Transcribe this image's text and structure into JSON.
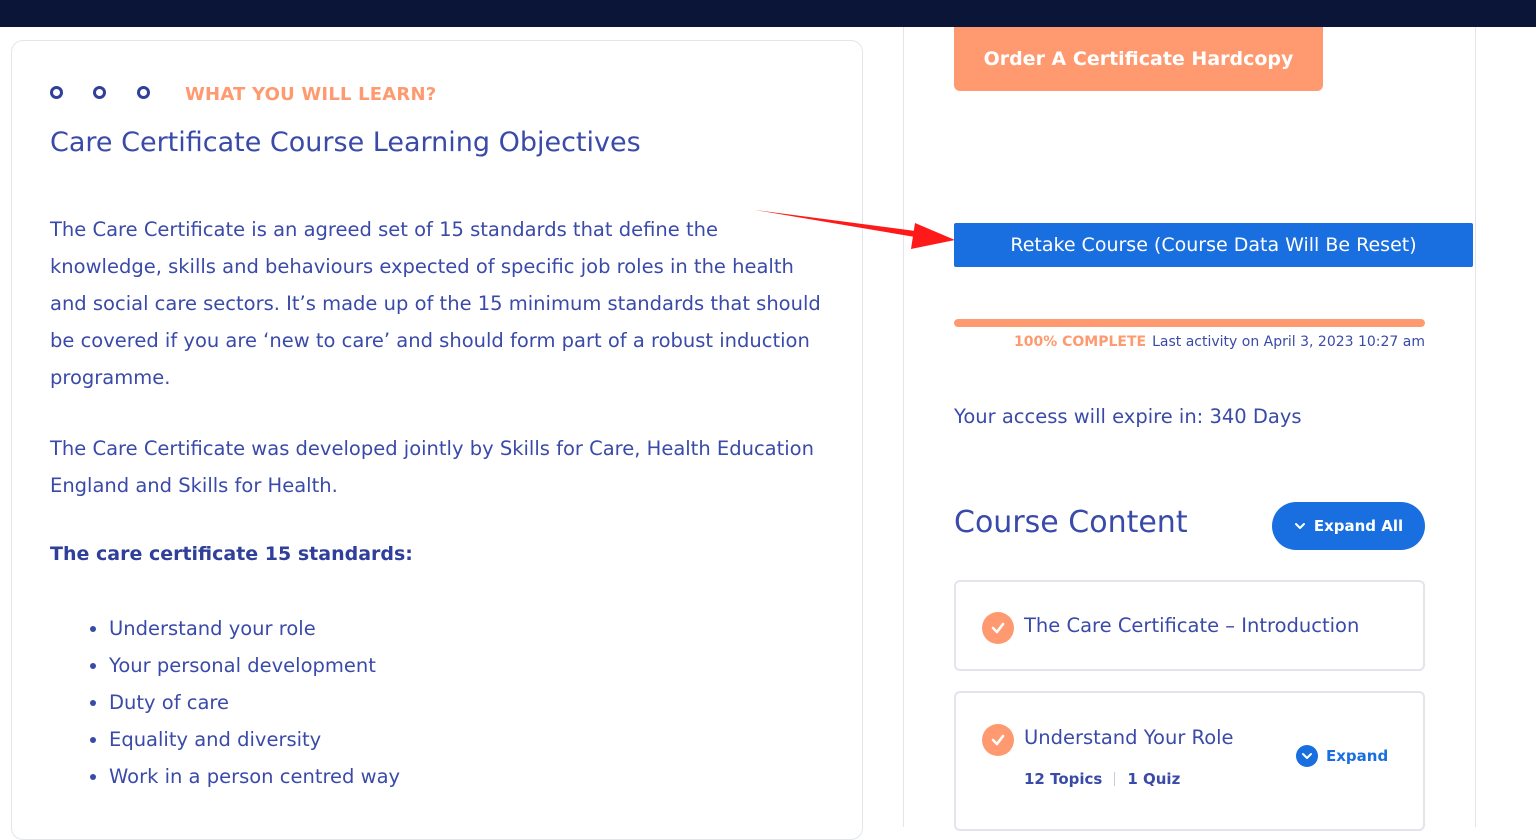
{
  "colors": {
    "navy": "#0a1538",
    "text": "#3a4aa8",
    "accent_orange": "#ff9a70",
    "primary_blue": "#1a6fe0",
    "arrow_red": "#ff1a1a"
  },
  "main": {
    "eyebrow": "WHAT YOU WILL LEARN?",
    "title": "Care Certificate Course Learning Objectives",
    "paragraph_1": "The Care Certificate is an agreed set of 15 standards that define the knowledge, skills and behaviours expected of specific job roles in the health and social care sectors. It’s made up of the 15 minimum standards that should be covered if you are ‘new to care’ and should form part of a robust induction programme.",
    "paragraph_2": "The Care Certificate was developed jointly by Skills for Care, Health Education England and Skills for Health.",
    "standards_heading": "The care certificate 15 standards:",
    "standards": [
      "Understand your role",
      "Your personal development",
      "Duty of care",
      "Equality and diversity",
      "Work in a person centred way"
    ]
  },
  "sidebar": {
    "order_button": "Order A Certificate Hardcopy",
    "retake_button": "Retake Course (Course Data Will Be Reset)",
    "progress": {
      "percent": 100,
      "status_label": "100% COMPLETE",
      "last_activity": "Last activity on April 3, 2023 10:27 am"
    },
    "access_expiry": "Your access will expire in: 340 Days",
    "course_content_title": "Course Content",
    "expand_all_label": "Expand All",
    "lessons": [
      {
        "title": "The Care Certificate – Introduction",
        "completed": true
      },
      {
        "title": "Understand Your Role",
        "completed": true,
        "topics": "12 Topics",
        "quiz": "1 Quiz",
        "expand_label": "Expand"
      }
    ]
  }
}
